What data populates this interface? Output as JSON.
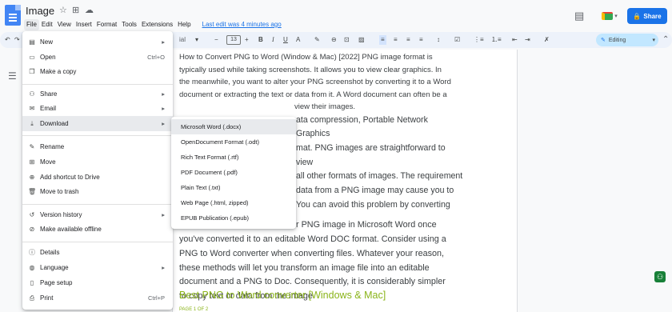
{
  "app": {
    "title": "Image",
    "last_edit": "Last edit was 4 minutes ago"
  },
  "menubar": [
    "File",
    "Edit",
    "View",
    "Insert",
    "Format",
    "Tools",
    "Extensions",
    "Help"
  ],
  "share": {
    "label": "Share"
  },
  "toolbar": {
    "font_size": "13",
    "mode": "Editing",
    "font_partial": "ial"
  },
  "file_menu": {
    "items": [
      {
        "icon": "new-doc-icon",
        "label": "New",
        "right": "▸"
      },
      {
        "icon": "folder-open-icon",
        "label": "Open",
        "right": "Ctrl+O"
      },
      {
        "icon": "copy-icon",
        "label": "Make a copy",
        "right": ""
      },
      {
        "icon": "share-icon",
        "label": "Share",
        "right": "▸"
      },
      {
        "icon": "email-icon",
        "label": "Email",
        "right": "▸"
      },
      {
        "icon": "download-icon",
        "label": "Download",
        "right": "▸"
      },
      {
        "icon": "rename-icon",
        "label": "Rename",
        "right": ""
      },
      {
        "icon": "move-icon",
        "label": "Move",
        "right": ""
      },
      {
        "icon": "drive-shortcut-icon",
        "label": "Add shortcut to Drive",
        "right": ""
      },
      {
        "icon": "trash-icon",
        "label": "Move to trash",
        "right": ""
      },
      {
        "icon": "history-icon",
        "label": "Version history",
        "right": "▸"
      },
      {
        "icon": "offline-icon",
        "label": "Make available offline",
        "right": ""
      },
      {
        "icon": "info-icon",
        "label": "Details",
        "right": ""
      },
      {
        "icon": "globe-icon",
        "label": "Language",
        "right": "▸"
      },
      {
        "icon": "page-setup-icon",
        "label": "Page setup",
        "right": ""
      },
      {
        "icon": "print-icon",
        "label": "Print",
        "right": "Ctrl+P"
      }
    ]
  },
  "download_menu": {
    "items": [
      "Microsoft Word (.docx)",
      "OpenDocument Format (.odt)",
      "Rich Text Format (.rtf)",
      "PDF Document (.pdf)",
      "Plain Text (.txt)",
      "Web Page (.html, zipped)",
      "EPUB Publication (.epub)"
    ]
  },
  "document": {
    "p1_lines": [
      "How to Convert PNG to Word (Window & Mac) [2022] PNG image format is",
      "typically used while taking screenshots. It allows you to view clear graphics. In",
      "the meanwhile, you want to alter your PNG screenshot by converting it to a Word",
      "document or extracting the text or data from it. A Word document can often be a",
      "view their images."
    ],
    "p2_lines": [
      "ata compression, Portable Network Graphics",
      "mat. PNG images are straightforward to view",
      "all other formats of images. The requirement",
      "data from a PNG image may cause you to",
      "You can avoid this problem by converting"
    ],
    "p3_lines": [
      "r PNG image in Microsoft Word once",
      "you've converted it to an editable Word DOC format. Consider using a",
      "PNG to Word converter when converting files. Whatever your reason,",
      "these methods will let you transform an image file into an editable",
      "document and a PNG to Doc. Consequently, it is considerably simpler",
      "to copy text or data from the image."
    ],
    "heading": "Best PNG to Word converter [Windows & Mac]",
    "page_label": "PAGE 1 OF 2"
  },
  "colors": {
    "accent": "#1a73e8",
    "heading": "#8ab419",
    "editing_bg": "#c2e7ff"
  }
}
